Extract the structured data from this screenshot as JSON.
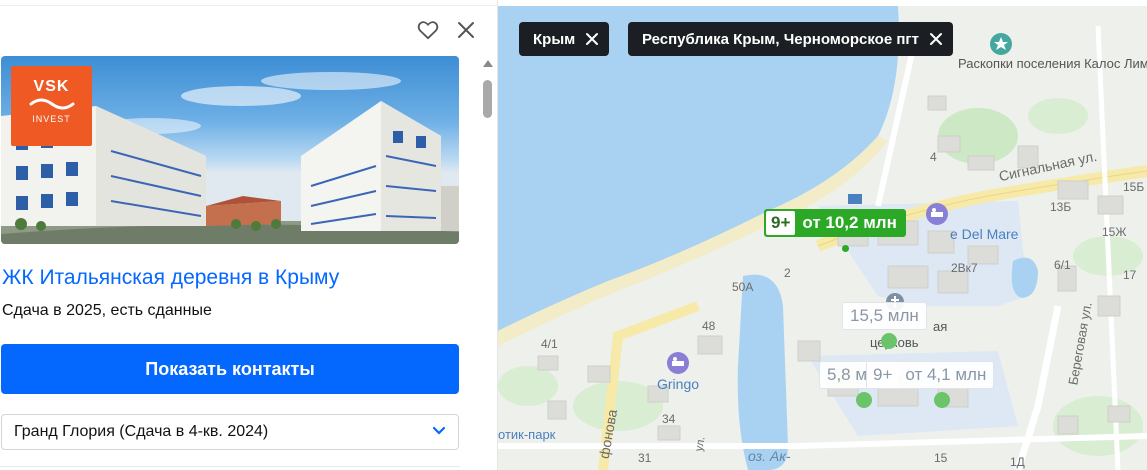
{
  "card": {
    "favorite_icon": "heart-outline-icon",
    "close_icon": "close-icon",
    "logo": {
      "brand": "VSK",
      "sub": "INVEST"
    },
    "title": "ЖК Итальянская деревня в Крыму",
    "subtitle": "Сдача в 2025, есть сданные",
    "contact_button": "Показать контакты",
    "select_value": "Гранд Глория (Сдача в 4-кв. 2024)"
  },
  "map": {
    "filters": [
      {
        "label": "Крым"
      },
      {
        "label": "Республика Крым, Черноморское пгт"
      }
    ],
    "labels": {
      "poi_ruins": "Раскопки поселения Калос Лимен",
      "street_signal": "Сигнальная ул.",
      "street_beregovaya": "Береговая ул.",
      "street_afonova": "фонова",
      "hotel_mare": "e Del Mare",
      "gringo": "Gringo",
      "park": "отик-парк",
      "lake": "оз. Ак-",
      "church_part1": "ая",
      "church_part2": "церковь",
      "h4": "4",
      "h15b": "15Б",
      "h13b": "13Б",
      "h15zh": "15Ж",
      "h2vk7": "2Вк7",
      "h6_1": "6/1",
      "h17": "17",
      "h2": "2",
      "h50a": "50A",
      "h48": "48",
      "h4_1": "4/1",
      "h34": "34",
      "h31": "31",
      "h15": "15",
      "h1d": "1Д",
      "street_ul": "ул."
    },
    "markers": [
      {
        "count": "9+",
        "price": "от 10,2 млн",
        "style": "active"
      },
      {
        "count": "",
        "price": "15,5 млн",
        "style": "muted"
      },
      {
        "count": "",
        "price": "5,8 м",
        "style": "muted"
      },
      {
        "count": "9+",
        "price": "от 4,1 млн",
        "style": "muted"
      }
    ]
  },
  "colors": {
    "accent": "#0468ff",
    "marker_green": "#2aa826",
    "water": "#a9d2f2",
    "chip_bg": "#1b1f24"
  }
}
